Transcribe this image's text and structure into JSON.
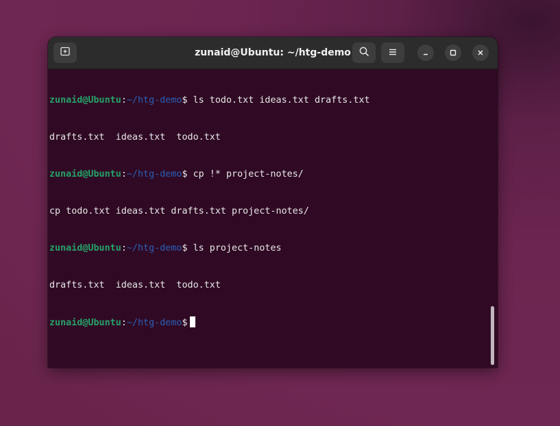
{
  "window": {
    "title": "zunaid@Ubuntu: ~/htg-demo"
  },
  "header": {
    "new_tab_icon": "new-tab-icon",
    "search_icon": "search-icon",
    "menu_icon": "hamburger-menu-icon",
    "minimize_icon": "minimize-icon",
    "maximize_icon": "maximize-icon",
    "close_icon": "close-icon"
  },
  "terminal": {
    "user_host": "zunaid@Ubuntu",
    "separator": ":",
    "path": "~/htg-demo",
    "prompt_symbol": "$",
    "lines": [
      {
        "type": "prompt",
        "command": " ls todo.txt ideas.txt drafts.txt"
      },
      {
        "type": "output",
        "text": "drafts.txt  ideas.txt  todo.txt"
      },
      {
        "type": "prompt",
        "command": " cp !* project-notes/"
      },
      {
        "type": "output",
        "text": "cp todo.txt ideas.txt drafts.txt project-notes/"
      },
      {
        "type": "prompt",
        "command": " ls project-notes"
      },
      {
        "type": "output",
        "text": "drafts.txt  ideas.txt  todo.txt"
      },
      {
        "type": "prompt",
        "command": " "
      }
    ]
  },
  "colors": {
    "desktop": "#6e2752",
    "terminal_bg": "#300a24",
    "headerbar": "#2c2c2c",
    "prompt_user": "#26a269",
    "prompt_path": "#2a5fb8",
    "text": "#e8e8e8"
  }
}
